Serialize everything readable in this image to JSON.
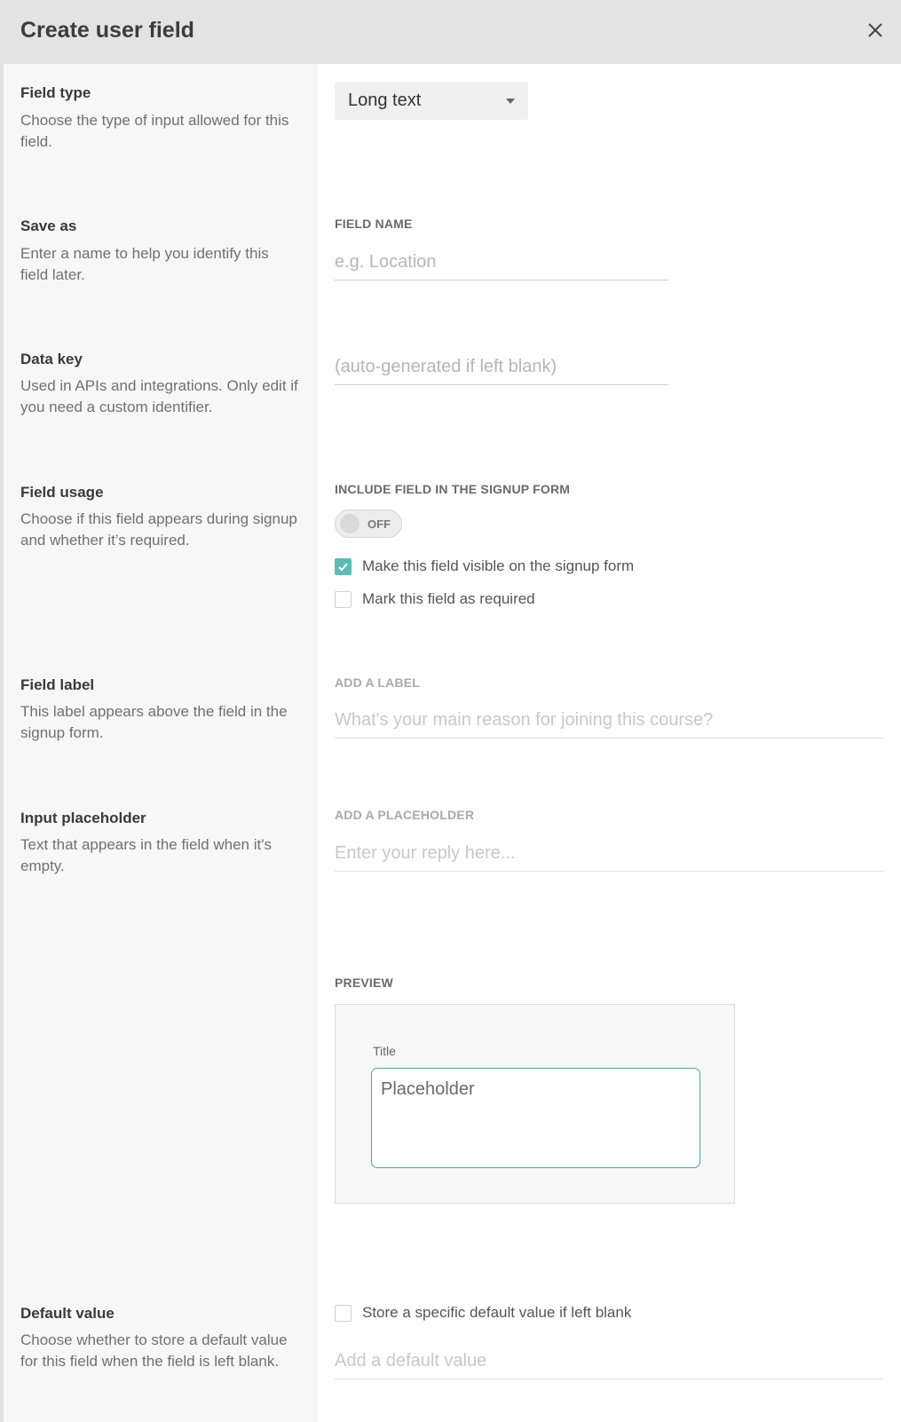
{
  "header": {
    "title": "Create user field"
  },
  "sections": {
    "field_type": {
      "title": "Field type",
      "desc": "Choose the type of input allowed for this field.",
      "select_value": "Long text"
    },
    "save_as": {
      "title": "Save as",
      "desc": "Enter a name to help you identify this field later.",
      "label": "FIELD NAME",
      "placeholder": "e.g. Location"
    },
    "data_key": {
      "title": "Data key",
      "desc": "Used in APIs and integrations. Only edit if you need a custom identifier.",
      "placeholder": "(auto-generated if left blank)"
    },
    "field_usage": {
      "title": "Field usage",
      "desc": "Choose if this field appears during signup and whether it’s required.",
      "label": "INCLUDE FIELD IN THE SIGNUP FORM",
      "toggle_text": "OFF",
      "visible_label": "Make this field visible on the signup form",
      "visible_checked": true,
      "required_label": "Mark this field as required",
      "required_checked": false
    },
    "field_label": {
      "title": "Field label",
      "desc": "This label appears above the field in the signup form.",
      "label": "ADD A LABEL",
      "placeholder": "What's your main reason for joining this course?"
    },
    "input_placeholder": {
      "title": "Input placeholder",
      "desc": "Text that appears in the field when it's empty.",
      "label": "ADD A PLACEHOLDER",
      "placeholder": "Enter your reply here..."
    },
    "preview": {
      "label": "PREVIEW",
      "title": "Title",
      "placeholder": "Placeholder"
    },
    "default_value": {
      "title": "Default value",
      "desc": "Choose whether to store a default value for this field when the field is left blank.",
      "checkbox_label": "Store a specific default value if left blank",
      "checkbox_checked": false,
      "placeholder": "Add a default value"
    }
  },
  "colors": {
    "accent": "#5cbcb4",
    "header_bg": "#e3e3e3",
    "sidebar_bg": "#f7f7f7"
  }
}
